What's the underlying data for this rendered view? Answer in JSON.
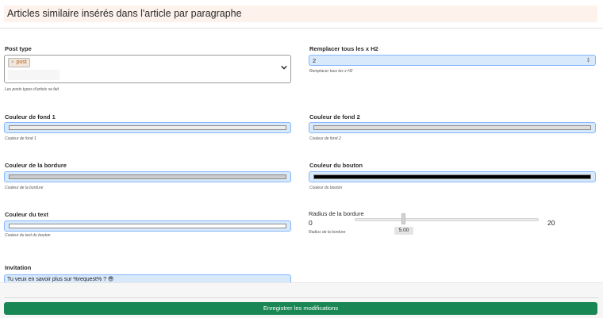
{
  "header": {
    "title": "Articles similaire insérés dans l'article par paragraphe"
  },
  "post_type": {
    "label": "Post type",
    "chip_remove": "×",
    "chip_label": "post",
    "help": "Les posts types d'article se fait"
  },
  "replace_h2": {
    "label": "Remplacer tous les x H2",
    "value": "2",
    "spin_up": "▲",
    "spin_down": "▼",
    "help": "Remplacer tous les x H2"
  },
  "bg_color_1": {
    "label": "Couleur de fond 1",
    "help": "Couleur de fond 1",
    "color": "#eeeeee"
  },
  "bg_color_2": {
    "label": "Couleur de fond 2",
    "help": "Couleur de fond 2",
    "color": "#dddddd"
  },
  "border_color": {
    "label": "Couleur de la bordure",
    "help": "Couleur de la bordure",
    "color": "#cccccc"
  },
  "button_color": {
    "label": "Couleur du bouton",
    "help": "Couleur du bouton",
    "color": "#000000"
  },
  "text_color": {
    "label": "Couleur du text",
    "help": "Couleur du text du bouton",
    "color": "#ffffff"
  },
  "border_radius": {
    "label": "Radius de la bordure",
    "min": "0",
    "max": "20",
    "value": "5.00",
    "help": "Radius de la bordure"
  },
  "invitation": {
    "label": "Invitation",
    "value": "Tu veux en savoir plus sur %request% ? 😎"
  },
  "footer": {
    "save_label": "Enregistrer les modifications"
  }
}
